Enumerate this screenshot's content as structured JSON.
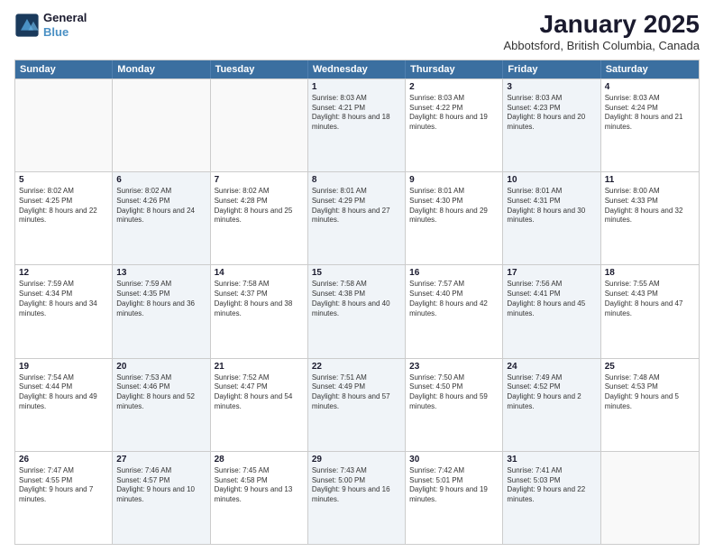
{
  "header": {
    "logo_line1": "General",
    "logo_line2": "Blue",
    "title": "January 2025",
    "subtitle": "Abbotsford, British Columbia, Canada"
  },
  "weekdays": [
    "Sunday",
    "Monday",
    "Tuesday",
    "Wednesday",
    "Thursday",
    "Friday",
    "Saturday"
  ],
  "weeks": [
    [
      {
        "day": "",
        "sunrise": "",
        "sunset": "",
        "daylight": "",
        "shaded": false,
        "empty": true
      },
      {
        "day": "",
        "sunrise": "",
        "sunset": "",
        "daylight": "",
        "shaded": false,
        "empty": true
      },
      {
        "day": "",
        "sunrise": "",
        "sunset": "",
        "daylight": "",
        "shaded": false,
        "empty": true
      },
      {
        "day": "1",
        "sunrise": "Sunrise: 8:03 AM",
        "sunset": "Sunset: 4:21 PM",
        "daylight": "Daylight: 8 hours and 18 minutes.",
        "shaded": true,
        "empty": false
      },
      {
        "day": "2",
        "sunrise": "Sunrise: 8:03 AM",
        "sunset": "Sunset: 4:22 PM",
        "daylight": "Daylight: 8 hours and 19 minutes.",
        "shaded": false,
        "empty": false
      },
      {
        "day": "3",
        "sunrise": "Sunrise: 8:03 AM",
        "sunset": "Sunset: 4:23 PM",
        "daylight": "Daylight: 8 hours and 20 minutes.",
        "shaded": true,
        "empty": false
      },
      {
        "day": "4",
        "sunrise": "Sunrise: 8:03 AM",
        "sunset": "Sunset: 4:24 PM",
        "daylight": "Daylight: 8 hours and 21 minutes.",
        "shaded": false,
        "empty": false
      }
    ],
    [
      {
        "day": "5",
        "sunrise": "Sunrise: 8:02 AM",
        "sunset": "Sunset: 4:25 PM",
        "daylight": "Daylight: 8 hours and 22 minutes.",
        "shaded": false,
        "empty": false
      },
      {
        "day": "6",
        "sunrise": "Sunrise: 8:02 AM",
        "sunset": "Sunset: 4:26 PM",
        "daylight": "Daylight: 8 hours and 24 minutes.",
        "shaded": true,
        "empty": false
      },
      {
        "day": "7",
        "sunrise": "Sunrise: 8:02 AM",
        "sunset": "Sunset: 4:28 PM",
        "daylight": "Daylight: 8 hours and 25 minutes.",
        "shaded": false,
        "empty": false
      },
      {
        "day": "8",
        "sunrise": "Sunrise: 8:01 AM",
        "sunset": "Sunset: 4:29 PM",
        "daylight": "Daylight: 8 hours and 27 minutes.",
        "shaded": true,
        "empty": false
      },
      {
        "day": "9",
        "sunrise": "Sunrise: 8:01 AM",
        "sunset": "Sunset: 4:30 PM",
        "daylight": "Daylight: 8 hours and 29 minutes.",
        "shaded": false,
        "empty": false
      },
      {
        "day": "10",
        "sunrise": "Sunrise: 8:01 AM",
        "sunset": "Sunset: 4:31 PM",
        "daylight": "Daylight: 8 hours and 30 minutes.",
        "shaded": true,
        "empty": false
      },
      {
        "day": "11",
        "sunrise": "Sunrise: 8:00 AM",
        "sunset": "Sunset: 4:33 PM",
        "daylight": "Daylight: 8 hours and 32 minutes.",
        "shaded": false,
        "empty": false
      }
    ],
    [
      {
        "day": "12",
        "sunrise": "Sunrise: 7:59 AM",
        "sunset": "Sunset: 4:34 PM",
        "daylight": "Daylight: 8 hours and 34 minutes.",
        "shaded": false,
        "empty": false
      },
      {
        "day": "13",
        "sunrise": "Sunrise: 7:59 AM",
        "sunset": "Sunset: 4:35 PM",
        "daylight": "Daylight: 8 hours and 36 minutes.",
        "shaded": true,
        "empty": false
      },
      {
        "day": "14",
        "sunrise": "Sunrise: 7:58 AM",
        "sunset": "Sunset: 4:37 PM",
        "daylight": "Daylight: 8 hours and 38 minutes.",
        "shaded": false,
        "empty": false
      },
      {
        "day": "15",
        "sunrise": "Sunrise: 7:58 AM",
        "sunset": "Sunset: 4:38 PM",
        "daylight": "Daylight: 8 hours and 40 minutes.",
        "shaded": true,
        "empty": false
      },
      {
        "day": "16",
        "sunrise": "Sunrise: 7:57 AM",
        "sunset": "Sunset: 4:40 PM",
        "daylight": "Daylight: 8 hours and 42 minutes.",
        "shaded": false,
        "empty": false
      },
      {
        "day": "17",
        "sunrise": "Sunrise: 7:56 AM",
        "sunset": "Sunset: 4:41 PM",
        "daylight": "Daylight: 8 hours and 45 minutes.",
        "shaded": true,
        "empty": false
      },
      {
        "day": "18",
        "sunrise": "Sunrise: 7:55 AM",
        "sunset": "Sunset: 4:43 PM",
        "daylight": "Daylight: 8 hours and 47 minutes.",
        "shaded": false,
        "empty": false
      }
    ],
    [
      {
        "day": "19",
        "sunrise": "Sunrise: 7:54 AM",
        "sunset": "Sunset: 4:44 PM",
        "daylight": "Daylight: 8 hours and 49 minutes.",
        "shaded": false,
        "empty": false
      },
      {
        "day": "20",
        "sunrise": "Sunrise: 7:53 AM",
        "sunset": "Sunset: 4:46 PM",
        "daylight": "Daylight: 8 hours and 52 minutes.",
        "shaded": true,
        "empty": false
      },
      {
        "day": "21",
        "sunrise": "Sunrise: 7:52 AM",
        "sunset": "Sunset: 4:47 PM",
        "daylight": "Daylight: 8 hours and 54 minutes.",
        "shaded": false,
        "empty": false
      },
      {
        "day": "22",
        "sunrise": "Sunrise: 7:51 AM",
        "sunset": "Sunset: 4:49 PM",
        "daylight": "Daylight: 8 hours and 57 minutes.",
        "shaded": true,
        "empty": false
      },
      {
        "day": "23",
        "sunrise": "Sunrise: 7:50 AM",
        "sunset": "Sunset: 4:50 PM",
        "daylight": "Daylight: 8 hours and 59 minutes.",
        "shaded": false,
        "empty": false
      },
      {
        "day": "24",
        "sunrise": "Sunrise: 7:49 AM",
        "sunset": "Sunset: 4:52 PM",
        "daylight": "Daylight: 9 hours and 2 minutes.",
        "shaded": true,
        "empty": false
      },
      {
        "day": "25",
        "sunrise": "Sunrise: 7:48 AM",
        "sunset": "Sunset: 4:53 PM",
        "daylight": "Daylight: 9 hours and 5 minutes.",
        "shaded": false,
        "empty": false
      }
    ],
    [
      {
        "day": "26",
        "sunrise": "Sunrise: 7:47 AM",
        "sunset": "Sunset: 4:55 PM",
        "daylight": "Daylight: 9 hours and 7 minutes.",
        "shaded": false,
        "empty": false
      },
      {
        "day": "27",
        "sunrise": "Sunrise: 7:46 AM",
        "sunset": "Sunset: 4:57 PM",
        "daylight": "Daylight: 9 hours and 10 minutes.",
        "shaded": true,
        "empty": false
      },
      {
        "day": "28",
        "sunrise": "Sunrise: 7:45 AM",
        "sunset": "Sunset: 4:58 PM",
        "daylight": "Daylight: 9 hours and 13 minutes.",
        "shaded": false,
        "empty": false
      },
      {
        "day": "29",
        "sunrise": "Sunrise: 7:43 AM",
        "sunset": "Sunset: 5:00 PM",
        "daylight": "Daylight: 9 hours and 16 minutes.",
        "shaded": true,
        "empty": false
      },
      {
        "day": "30",
        "sunrise": "Sunrise: 7:42 AM",
        "sunset": "Sunset: 5:01 PM",
        "daylight": "Daylight: 9 hours and 19 minutes.",
        "shaded": false,
        "empty": false
      },
      {
        "day": "31",
        "sunrise": "Sunrise: 7:41 AM",
        "sunset": "Sunset: 5:03 PM",
        "daylight": "Daylight: 9 hours and 22 minutes.",
        "shaded": true,
        "empty": false
      },
      {
        "day": "",
        "sunrise": "",
        "sunset": "",
        "daylight": "",
        "shaded": false,
        "empty": true
      }
    ]
  ]
}
